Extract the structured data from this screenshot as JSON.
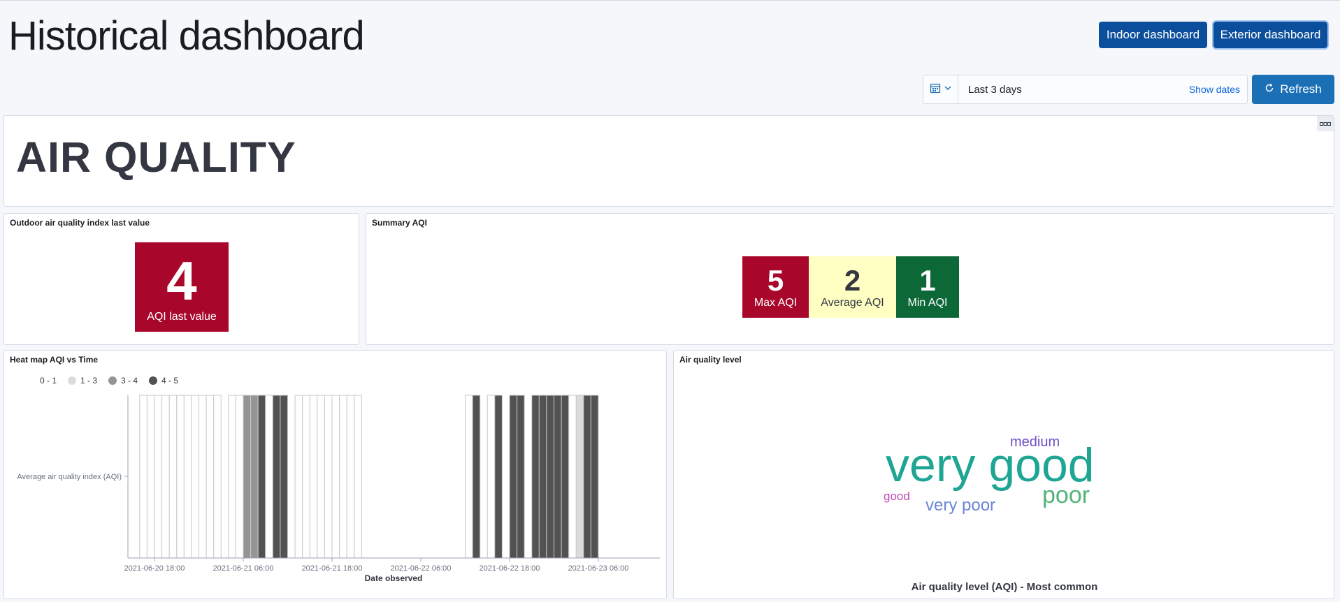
{
  "header": {
    "title": "Historical dashboard"
  },
  "nav": {
    "indoor_label": "Indoor dashboard",
    "exterior_label": "Exterior dashboard"
  },
  "date_picker": {
    "value": "Last 3 days",
    "show_dates": "Show dates",
    "icon": "calendar-icon"
  },
  "refresh": {
    "label": "Refresh",
    "icon": "refresh-icon"
  },
  "air_quality_panel": {
    "heading": "AIR QUALITY"
  },
  "last_value_panel": {
    "title": "Outdoor air quality index last value",
    "value": "4",
    "label": "AQI last value",
    "color": "#a8072b"
  },
  "summary_panel": {
    "title": "Summary AQI",
    "metrics": [
      {
        "value": "5",
        "label": "Max AQI",
        "color": "#a8072b"
      },
      {
        "value": "2",
        "label": "Average AQI",
        "color": "#ffffc3"
      },
      {
        "value": "1",
        "label": "Min AQI",
        "color": "#0d6838"
      }
    ]
  },
  "heatmap_panel": {
    "title": "Heat map AQI vs Time",
    "legend": [
      {
        "label": "0 - 1",
        "color": "#ffffff"
      },
      {
        "label": "1 - 3",
        "color": "#dcdcdc"
      },
      {
        "label": "3 - 4",
        "color": "#959595"
      },
      {
        "label": "4 - 5",
        "color": "#525252"
      }
    ]
  },
  "chart_data": {
    "type": "heatmap",
    "title": "Heat map AQI vs Time",
    "xlabel": "Date observed",
    "ylabel": "Average air quality index (AQI)",
    "x_ticks": [
      "2021-06-20 18:00",
      "2021-06-21 06:00",
      "2021-06-21 18:00",
      "2021-06-22 06:00",
      "2021-06-22 18:00",
      "2021-06-23 06:00"
    ],
    "hours_per_cell": 1,
    "series_start_time": "2021-06-20 16:00",
    "cells": [
      {
        "time": "2021-06-20 16:00",
        "range": "0 - 1"
      },
      {
        "time": "2021-06-20 17:00",
        "range": "0 - 1"
      },
      {
        "time": "2021-06-20 18:00",
        "range": "0 - 1"
      },
      {
        "time": "2021-06-20 19:00",
        "range": "0 - 1"
      },
      {
        "time": "2021-06-20 20:00",
        "range": "0 - 1"
      },
      {
        "time": "2021-06-20 21:00",
        "range": "0 - 1"
      },
      {
        "time": "2021-06-20 22:00",
        "range": "0 - 1"
      },
      {
        "time": "2021-06-20 23:00",
        "range": "0 - 1"
      },
      {
        "time": "2021-06-21 00:00",
        "range": "0 - 1"
      },
      {
        "time": "2021-06-21 01:00",
        "range": "0 - 1"
      },
      {
        "time": "2021-06-21 02:00",
        "range": "0 - 1"
      },
      {
        "time": "2021-06-21 04:00",
        "range": "0 - 1"
      },
      {
        "time": "2021-06-21 05:00",
        "range": "0 - 1"
      },
      {
        "time": "2021-06-21 06:00",
        "range": "3 - 4"
      },
      {
        "time": "2021-06-21 07:00",
        "range": "3 - 4"
      },
      {
        "time": "2021-06-21 08:00",
        "range": "4 - 5"
      },
      {
        "time": "2021-06-21 09:00",
        "range": "0 - 1"
      },
      {
        "time": "2021-06-21 10:00",
        "range": "4 - 5"
      },
      {
        "time": "2021-06-21 11:00",
        "range": "4 - 5"
      },
      {
        "time": "2021-06-21 13:00",
        "range": "0 - 1"
      },
      {
        "time": "2021-06-21 14:00",
        "range": "0 - 1"
      },
      {
        "time": "2021-06-21 15:00",
        "range": "0 - 1"
      },
      {
        "time": "2021-06-21 16:00",
        "range": "0 - 1"
      },
      {
        "time": "2021-06-21 17:00",
        "range": "0 - 1"
      },
      {
        "time": "2021-06-21 18:00",
        "range": "0 - 1"
      },
      {
        "time": "2021-06-21 19:00",
        "range": "0 - 1"
      },
      {
        "time": "2021-06-21 20:00",
        "range": "0 - 1"
      },
      {
        "time": "2021-06-21 21:00",
        "range": "0 - 1"
      },
      {
        "time": "2021-06-22 12:00",
        "range": "0 - 1"
      },
      {
        "time": "2021-06-22 13:00",
        "range": "4 - 5"
      },
      {
        "time": "2021-06-22 15:00",
        "range": "0 - 1"
      },
      {
        "time": "2021-06-22 16:00",
        "range": "4 - 5"
      },
      {
        "time": "2021-06-22 18:00",
        "range": "4 - 5"
      },
      {
        "time": "2021-06-22 19:00",
        "range": "4 - 5"
      },
      {
        "time": "2021-06-22 21:00",
        "range": "4 - 5"
      },
      {
        "time": "2021-06-22 22:00",
        "range": "4 - 5"
      },
      {
        "time": "2021-06-22 23:00",
        "range": "4 - 5"
      },
      {
        "time": "2021-06-23 00:00",
        "range": "4 - 5"
      },
      {
        "time": "2021-06-23 01:00",
        "range": "4 - 5"
      },
      {
        "time": "2021-06-23 02:00",
        "range": "0 - 1"
      },
      {
        "time": "2021-06-23 03:00",
        "range": "1 - 3"
      },
      {
        "time": "2021-06-23 04:00",
        "range": "4 - 5"
      },
      {
        "time": "2021-06-23 05:00",
        "range": "4 - 5"
      }
    ],
    "grid": false
  },
  "level_panel": {
    "title": "Air quality level",
    "caption": "Air quality level (AQI) - Most common",
    "words": [
      {
        "text": "very good",
        "color": "#1ea593"
      },
      {
        "text": "medium",
        "color": "#6f4ec4"
      },
      {
        "text": "poor",
        "color": "#54b37a"
      },
      {
        "text": "very poor",
        "color": "#6b86d6"
      },
      {
        "text": "good",
        "color": "#c24ab5"
      }
    ]
  }
}
